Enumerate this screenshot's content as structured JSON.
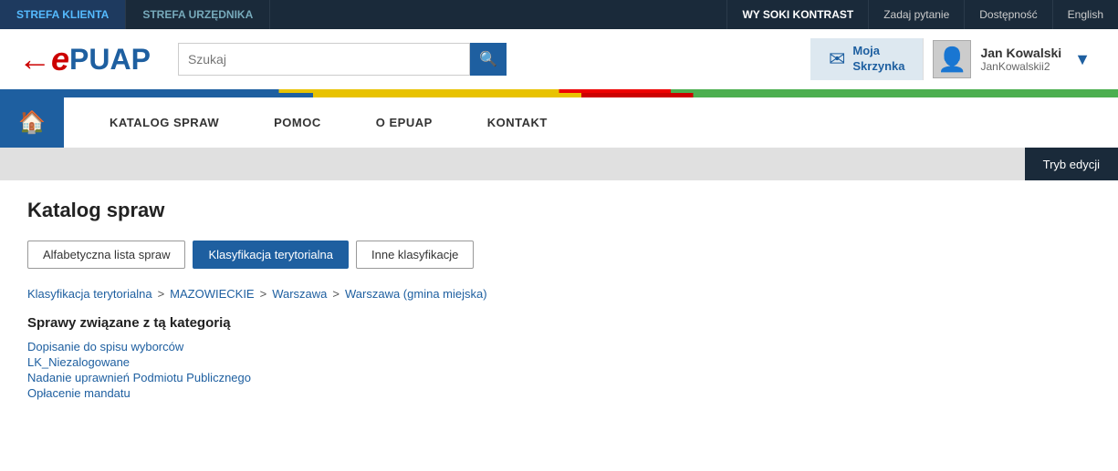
{
  "topBar": {
    "tabs": [
      {
        "label": "STREFA KLIENTA",
        "active": true
      },
      {
        "label": "STREFA URZĘDNIKA",
        "active": false
      }
    ],
    "rightItems": [
      {
        "label": "WY SOKI KONTRAST",
        "id": "contrast"
      },
      {
        "label": "Zadaj pytanie",
        "id": "ask"
      },
      {
        "label": "Dostępność",
        "id": "accessibility"
      },
      {
        "label": "English",
        "id": "english"
      }
    ]
  },
  "header": {
    "logoText": "ePUAP",
    "searchPlaceholder": "Szukaj",
    "searchIcon": "🔍",
    "mailboxLabel1": "Moja",
    "mailboxLabel2": "Skrzynka",
    "userName": "Jan Kowalski",
    "userLogin": "JanKowalskii2"
  },
  "nav": {
    "homeIcon": "🏠",
    "items": [
      {
        "label": "KATALOG SPRAW"
      },
      {
        "label": "POMOC"
      },
      {
        "label": "O ePUAP"
      },
      {
        "label": "KONTAKT"
      }
    ]
  },
  "contentBar": {
    "tryEdycjiLabel": "Tryb edycji"
  },
  "main": {
    "pageTitle": "Katalog spraw",
    "filterButtons": [
      {
        "label": "Alfabetyczna lista spraw",
        "active": false
      },
      {
        "label": "Klasyfikacja terytorialna",
        "active": true
      },
      {
        "label": "Inne klasyfikacje",
        "active": false
      }
    ],
    "breadcrumb": [
      {
        "label": "Klasyfikacja terytorialna",
        "link": true
      },
      {
        "label": "MAZOWIECKIE",
        "link": true
      },
      {
        "label": "Warszawa",
        "link": true
      },
      {
        "label": "Warszawa (gmina miejska)",
        "link": true
      }
    ],
    "categoryTitle": "Sprawy związane z tą kategorią",
    "items": [
      {
        "label": "Dopisanie do spisu wyborców"
      },
      {
        "label": "LK_Niezalogowane"
      },
      {
        "label": "Nadanie uprawnień Podmiotu Publicznego"
      },
      {
        "label": "Opłacenie mandatu"
      }
    ]
  }
}
